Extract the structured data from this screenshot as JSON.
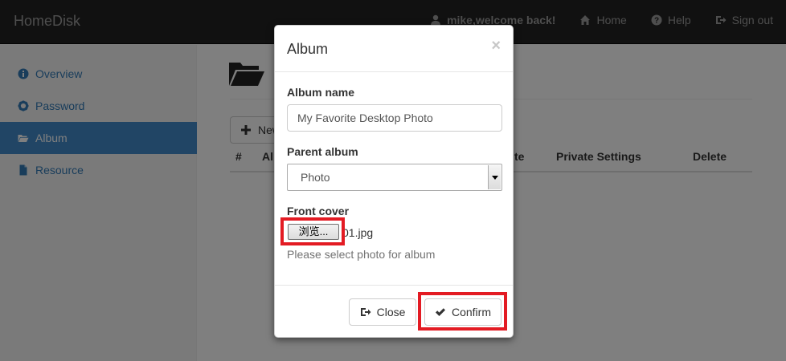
{
  "navbar": {
    "brand": "HomeDisk",
    "user_text": "mike,welcome back!",
    "home_label": "Home",
    "help_label": "Help",
    "signout_label": "Sign out"
  },
  "sidebar": {
    "items": [
      {
        "label": "Overview",
        "icon": "info-icon"
      },
      {
        "label": "Password",
        "icon": "gear-icon"
      },
      {
        "label": "Album",
        "icon": "folder-open-icon",
        "active": true
      },
      {
        "label": "Resource",
        "icon": "file-icon"
      }
    ]
  },
  "main": {
    "new_button_label": "New",
    "columns": [
      "#",
      "Al",
      "te",
      "Private Settings",
      "Delete"
    ]
  },
  "modal": {
    "title": "Album",
    "close_glyph": "×",
    "album_name_label": "Album name",
    "album_name_value": "My Favorite Desktop Photo",
    "parent_album_label": "Parent album",
    "parent_album_value": "Photo",
    "front_cover_label": "Front cover",
    "browse_label": "浏览...",
    "file_name": "01.jpg",
    "help_text": "Please select photo for album",
    "close_button_label": "Close",
    "confirm_button_label": "Confirm"
  },
  "colors": {
    "navbar_bg": "#222222",
    "sidebar_active": "#428bca",
    "link": "#337ab7",
    "highlight": "#e31b23"
  }
}
